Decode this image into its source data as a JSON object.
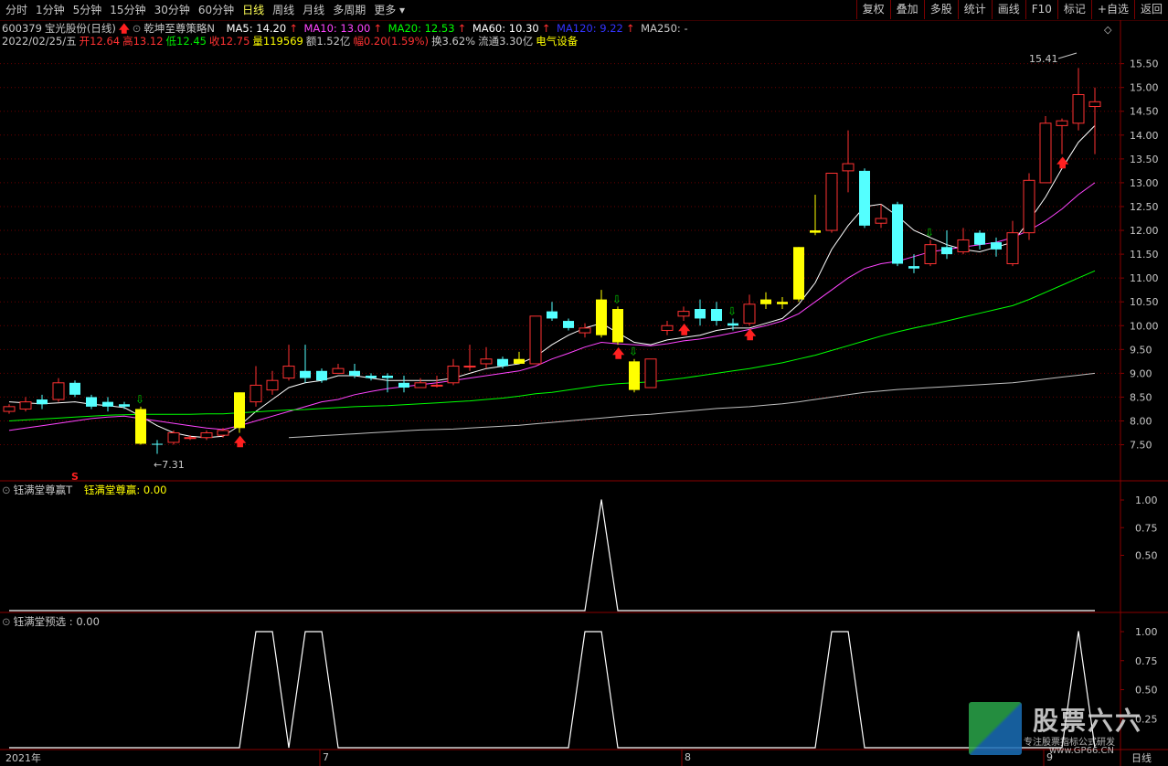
{
  "toolbar": {
    "periods": [
      "分时",
      "1分钟",
      "5分钟",
      "15分钟",
      "30分钟",
      "60分钟",
      "日线",
      "周线",
      "月线",
      "多周期",
      "更多"
    ],
    "active_period": "日线",
    "right_buttons": [
      "复权",
      "叠加",
      "多股",
      "统计",
      "画线",
      "F10",
      "标记",
      "+自选",
      "返回"
    ]
  },
  "header": {
    "code": "600379",
    "name": "宝光股份(日线)",
    "strategy": "乾坤至尊策略N",
    "ma5": "MA5: 14.20",
    "ma10": "MA10: 13.00",
    "ma20": "MA20: 12.53",
    "ma60": "MA60: 10.30",
    "ma120": "MA120: 9.22",
    "ma250": "MA250: -",
    "date": "2022/02/25/五",
    "open": "开12.64",
    "high": "高13.12",
    "low": "低12.45",
    "close": "收12.75",
    "volume": "量119569",
    "amount": "额1.52亿",
    "change": "幅0.20(1.59%)",
    "turnover": "换3.62%",
    "float": "流通3.30亿",
    "sector": "电气设备"
  },
  "annotations": {
    "high_label": "15.41",
    "low_label": "7.31",
    "s_marker": "S"
  },
  "panel2": {
    "title": "钰满堂尊赢T",
    "label": "钰满堂尊赢: 0.00"
  },
  "panel3": {
    "title": "钰满堂预选 : 0.00"
  },
  "x_axis": {
    "year": "2021年",
    "months": [
      "7",
      "8",
      "9"
    ],
    "period_label": "日线"
  },
  "watermark": {
    "main": "股票六六",
    "sub": "专注股票指标公式研发",
    "url": "www.GP66.CN"
  },
  "colors": {
    "up": "#ff3232",
    "down": "#54ffff",
    "ma5": "#ffffff",
    "ma10": "#ff44ff",
    "ma20": "#00ff00",
    "ma60": "#ffffff",
    "ma120": "#3333ff",
    "signal": "#ffff00"
  },
  "chart_data": [
    {
      "type": "candlestick",
      "title": "宝光股份(日线)",
      "y_ticks": [
        7.5,
        8.0,
        8.5,
        9.0,
        9.5,
        10.0,
        10.5,
        11.0,
        11.5,
        12.0,
        12.5,
        13.0,
        13.5,
        14.0,
        14.5,
        15.0,
        15.5
      ],
      "ylim": [
        7.05,
        15.8
      ],
      "candles": [
        [
          8.2,
          8.3,
          8.15,
          8.35
        ],
        [
          8.25,
          8.4,
          8.2,
          8.5
        ],
        [
          8.45,
          8.35,
          8.25,
          8.55
        ],
        [
          8.45,
          8.8,
          8.4,
          8.9
        ],
        [
          8.8,
          8.55,
          8.5,
          8.85
        ],
        [
          8.5,
          8.3,
          8.25,
          8.55
        ],
        [
          8.4,
          8.3,
          8.2,
          8.5
        ],
        [
          8.35,
          8.3,
          8.25,
          8.4
        ],
        [
          8.25,
          7.52,
          7.5,
          8.3
        ],
        [
          7.52,
          7.5,
          7.31,
          7.6
        ],
        [
          7.55,
          7.75,
          7.5,
          7.8
        ],
        [
          7.65,
          7.65,
          7.6,
          7.7
        ],
        [
          7.65,
          7.75,
          7.6,
          7.8
        ],
        [
          7.7,
          7.8,
          7.65,
          7.85
        ],
        [
          7.85,
          8.6,
          7.75,
          8.6
        ],
        [
          8.4,
          8.75,
          8.3,
          9.15
        ],
        [
          8.65,
          8.85,
          8.55,
          9.05
        ],
        [
          8.9,
          9.15,
          8.85,
          9.6
        ],
        [
          9.05,
          8.9,
          8.8,
          9.6
        ],
        [
          9.05,
          8.85,
          8.8,
          9.1
        ],
        [
          9.0,
          9.1,
          9.0,
          9.2
        ],
        [
          9.05,
          8.95,
          8.9,
          9.2
        ],
        [
          8.95,
          8.9,
          8.85,
          9.0
        ],
        [
          8.95,
          8.9,
          8.6,
          9.0
        ],
        [
          8.8,
          8.7,
          8.6,
          8.95
        ],
        [
          8.7,
          8.8,
          8.7,
          8.9
        ],
        [
          8.75,
          8.75,
          8.7,
          8.95
        ],
        [
          8.8,
          9.15,
          8.75,
          9.3
        ],
        [
          9.15,
          9.15,
          9.05,
          9.6
        ],
        [
          9.2,
          9.3,
          9.1,
          9.55
        ],
        [
          9.3,
          9.15,
          9.1,
          9.35
        ],
        [
          9.2,
          9.3,
          9.2,
          9.45
        ],
        [
          9.2,
          10.2,
          9.2,
          10.2
        ],
        [
          10.3,
          10.15,
          10.1,
          10.5
        ],
        [
          10.1,
          9.95,
          9.9,
          10.15
        ],
        [
          9.85,
          9.95,
          9.75,
          10.05
        ],
        [
          9.8,
          10.55,
          9.75,
          10.75
        ],
        [
          10.35,
          9.65,
          9.6,
          10.4
        ],
        [
          9.25,
          8.65,
          8.6,
          9.3
        ],
        [
          8.7,
          9.3,
          8.7,
          9.3
        ],
        [
          9.9,
          10.0,
          9.8,
          10.1
        ],
        [
          10.2,
          10.3,
          10.1,
          10.4
        ],
        [
          10.35,
          10.15,
          10.0,
          10.55
        ],
        [
          10.35,
          10.1,
          10.0,
          10.5
        ],
        [
          10.05,
          10.0,
          9.9,
          10.15
        ],
        [
          10.05,
          10.45,
          10.0,
          10.65
        ],
        [
          10.55,
          10.45,
          10.35,
          10.7
        ],
        [
          10.45,
          10.5,
          10.35,
          10.6
        ],
        [
          10.55,
          11.65,
          10.5,
          11.65
        ],
        [
          11.95,
          12.0,
          11.9,
          12.75
        ],
        [
          12.0,
          13.2,
          11.95,
          13.2
        ],
        [
          13.25,
          13.4,
          12.8,
          14.1
        ],
        [
          13.25,
          12.1,
          12.05,
          13.3
        ],
        [
          12.15,
          12.25,
          12.05,
          12.55
        ],
        [
          12.55,
          11.3,
          11.25,
          12.6
        ],
        [
          11.25,
          11.2,
          11.1,
          11.5
        ],
        [
          11.3,
          11.7,
          11.25,
          11.8
        ],
        [
          11.65,
          11.5,
          11.4,
          12.0
        ],
        [
          11.55,
          11.8,
          11.5,
          12.05
        ],
        [
          11.95,
          11.7,
          11.6,
          12.0
        ],
        [
          11.75,
          11.6,
          11.45,
          11.85
        ],
        [
          11.3,
          11.95,
          11.25,
          12.2
        ],
        [
          11.95,
          13.05,
          11.8,
          13.2
        ],
        [
          13.0,
          14.25,
          13.0,
          14.4
        ],
        [
          14.2,
          14.3,
          13.6,
          14.35
        ],
        [
          14.25,
          14.85,
          14.1,
          15.41
        ],
        [
          14.6,
          14.7,
          13.6,
          15.0
        ]
      ],
      "highlight_bars": [
        8,
        14,
        31,
        36,
        37,
        38,
        46,
        47,
        48,
        49
      ],
      "ma_series": {
        "MA5": [
          8.4,
          8.38,
          8.36,
          8.38,
          8.4,
          8.35,
          8.32,
          8.28,
          8.1,
          7.9,
          7.75,
          7.68,
          7.65,
          7.68,
          7.9,
          8.2,
          8.45,
          8.7,
          8.8,
          8.85,
          8.95,
          8.95,
          8.9,
          8.85,
          8.85,
          8.85,
          8.85,
          8.9,
          9.0,
          9.1,
          9.15,
          9.2,
          9.35,
          9.6,
          9.8,
          9.95,
          10.05,
          9.85,
          9.65,
          9.6,
          9.7,
          9.75,
          9.8,
          9.9,
          9.95,
          9.95,
          10.05,
          10.15,
          10.45,
          10.9,
          11.6,
          12.1,
          12.5,
          12.55,
          12.3,
          12.0,
          11.85,
          11.7,
          11.6,
          11.55,
          11.65,
          11.75,
          12.2,
          12.7,
          13.3,
          13.85,
          14.2
        ],
        "MA10": [
          7.8,
          7.85,
          7.9,
          7.95,
          8.0,
          8.05,
          8.08,
          8.1,
          8.05,
          8.0,
          7.95,
          7.9,
          7.85,
          7.82,
          7.9,
          8.0,
          8.1,
          8.2,
          8.3,
          8.4,
          8.45,
          8.55,
          8.62,
          8.68,
          8.72,
          8.76,
          8.8,
          8.85,
          8.9,
          8.95,
          9.0,
          9.05,
          9.15,
          9.3,
          9.42,
          9.55,
          9.65,
          9.62,
          9.6,
          9.58,
          9.62,
          9.68,
          9.72,
          9.78,
          9.85,
          9.92,
          10.0,
          10.1,
          10.25,
          10.5,
          10.75,
          11.0,
          11.2,
          11.3,
          11.35,
          11.45,
          11.55,
          11.6,
          11.65,
          11.7,
          11.75,
          11.85,
          12.0,
          12.2,
          12.45,
          12.75,
          13.0
        ],
        "MA20": [
          8.0,
          8.02,
          8.04,
          8.06,
          8.08,
          8.1,
          8.12,
          8.13,
          8.14,
          8.14,
          8.14,
          8.14,
          8.15,
          8.15,
          8.17,
          8.19,
          8.21,
          8.23,
          8.24,
          8.26,
          8.28,
          8.3,
          8.31,
          8.32,
          8.34,
          8.36,
          8.38,
          8.4,
          8.42,
          8.45,
          8.48,
          8.52,
          8.57,
          8.6,
          8.65,
          8.7,
          8.75,
          8.78,
          8.8,
          8.82,
          8.86,
          8.9,
          8.95,
          9.0,
          9.05,
          9.1,
          9.16,
          9.22,
          9.3,
          9.38,
          9.48,
          9.58,
          9.68,
          9.78,
          9.87,
          9.95,
          10.02,
          10.1,
          10.18,
          10.26,
          10.34,
          10.42,
          10.55,
          10.7,
          10.85,
          11.0,
          11.15
        ],
        "MA60": [
          null,
          null,
          null,
          null,
          null,
          null,
          null,
          null,
          null,
          null,
          null,
          null,
          null,
          null,
          null,
          null,
          null,
          7.65,
          7.67,
          7.69,
          7.71,
          7.73,
          7.75,
          7.77,
          7.79,
          7.81,
          7.82,
          7.83,
          7.85,
          7.87,
          7.89,
          7.91,
          7.94,
          7.97,
          8.0,
          8.03,
          8.06,
          8.09,
          8.12,
          8.14,
          8.17,
          8.2,
          8.23,
          8.26,
          8.28,
          8.3,
          8.33,
          8.36,
          8.4,
          8.45,
          8.5,
          8.55,
          8.6,
          8.63,
          8.66,
          8.68,
          8.7,
          8.72,
          8.74,
          8.76,
          8.78,
          8.8,
          8.84,
          8.88,
          8.92,
          8.96,
          9.0
        ]
      }
    },
    {
      "type": "line",
      "title": "钰满堂尊赢T",
      "y_ticks": [
        0.5,
        0.75,
        1.0
      ],
      "ylim": [
        0,
        1.0
      ],
      "values": [
        0,
        0,
        0,
        0,
        0,
        0,
        0,
        0,
        0,
        0,
        0,
        0,
        0,
        0,
        0,
        0,
        0,
        0,
        0,
        0,
        0,
        0,
        0,
        0,
        0,
        0,
        0,
        0,
        0,
        0,
        0,
        0,
        0,
        0,
        0,
        0,
        1,
        0,
        0,
        0,
        0,
        0,
        0,
        0,
        0,
        0,
        0,
        0,
        0,
        0,
        0,
        0,
        0,
        0,
        0,
        0,
        0,
        0,
        0,
        0,
        0,
        0,
        0,
        0,
        0,
        0,
        0
      ]
    },
    {
      "type": "line",
      "title": "钰满堂预选",
      "y_ticks": [
        0.25,
        0.5,
        0.75,
        1.0
      ],
      "ylim": [
        0,
        1.0
      ],
      "values": [
        0,
        0,
        0,
        0,
        0,
        0,
        0,
        0,
        0,
        0,
        0,
        0,
        0,
        0,
        0,
        1,
        1,
        0,
        1,
        1,
        0,
        0,
        0,
        0,
        0,
        0,
        0,
        0,
        0,
        0,
        0,
        0,
        0,
        0,
        0,
        1,
        1,
        0,
        0,
        0,
        0,
        0,
        0,
        0,
        0,
        0,
        0,
        0,
        0,
        0,
        1,
        1,
        0,
        0,
        0,
        0,
        0,
        0,
        0,
        0,
        0,
        0,
        0,
        0,
        0,
        1,
        0
      ]
    }
  ]
}
